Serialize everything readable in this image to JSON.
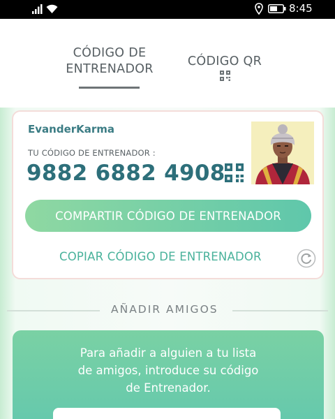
{
  "status_bar": {
    "time": "8:45",
    "icons": [
      "signal-icon",
      "wifi-icon",
      "location-icon",
      "battery-icon"
    ]
  },
  "tabs": {
    "trainer_code": "CÓDIGO DE\nENTRENADOR",
    "qr_code": "CÓDIGO QR",
    "active": "trainer_code"
  },
  "trainer": {
    "username": "EvanderKarma",
    "code_caption": "TU CÓDIGO DE ENTRENADOR :",
    "code": "9882 6882 4908"
  },
  "actions": {
    "share_label": "COMPARTIR CÓDIGO DE ENTRENADOR",
    "copy_label": "COPIAR CÓDIGO DE ENTRENADOR"
  },
  "add_friends": {
    "title": "AÑADIR AMIGOS",
    "instructions": "Para añadir a alguien a tu lista\nde amigos, introduce su código\nde Entrenador."
  },
  "colors": {
    "accent_green": "#5fc7ab",
    "code_teal": "#2d6f7a",
    "copy_green": "#49b29b"
  }
}
